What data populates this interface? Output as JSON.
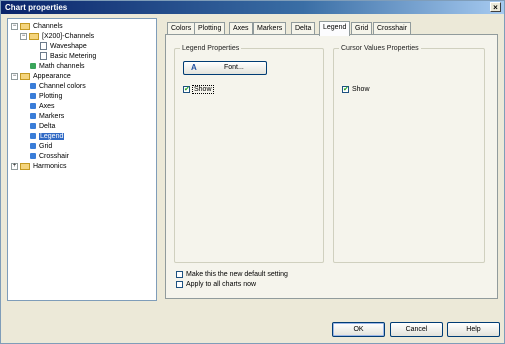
{
  "window": {
    "title": "Chart properties",
    "close_glyph": "×"
  },
  "tree": {
    "items": [
      {
        "label": "Channels",
        "expander": "−",
        "icon": "folder-icon"
      },
      {
        "label": "[X200]-Channels",
        "expander": "−",
        "icon": "folder-icon"
      },
      {
        "label": "Waveshape",
        "icon": "document-icon"
      },
      {
        "label": "Basic Metering",
        "icon": "document-icon"
      },
      {
        "label": "Math channels",
        "icon": "math-channels-icon"
      },
      {
        "label": "Appearance",
        "expander": "−",
        "icon": "folder-icon"
      },
      {
        "label": "Channel colors",
        "icon": "item-icon"
      },
      {
        "label": "Plotting",
        "icon": "item-icon"
      },
      {
        "label": "Axes",
        "icon": "item-icon"
      },
      {
        "label": "Markers",
        "icon": "item-icon"
      },
      {
        "label": "Delta",
        "icon": "item-icon"
      },
      {
        "label": "Legend",
        "icon": "item-icon",
        "selected": true
      },
      {
        "label": "Grid",
        "icon": "item-icon"
      },
      {
        "label": "Crosshair",
        "icon": "item-icon"
      },
      {
        "label": "Harmonics",
        "expander": "+",
        "icon": "folder-icon"
      }
    ]
  },
  "tabs": [
    "Colors",
    "Plotting",
    "Axes",
    "Markers",
    "Delta",
    "Legend",
    "Grid",
    "Crosshair"
  ],
  "active_tab": "Legend",
  "legend_group": {
    "title": "Legend Properties",
    "font_button": "Font...",
    "font_glyph": "A",
    "show_label": "Show",
    "show_checked": true
  },
  "cursor_group": {
    "title": "Cursor Values Properties",
    "show_label": "Show",
    "show_checked": true
  },
  "options": {
    "default_label": "Make this the new default setting",
    "apply_all_label": "Apply to all charts now"
  },
  "buttons": {
    "ok": "OK",
    "cancel": "Cancel",
    "help": "Help"
  },
  "check_mark": "✔",
  "colors": {
    "title_bar": "#0a246a",
    "selection": "#316ac5",
    "dialog_bg": "#ece9d8"
  }
}
